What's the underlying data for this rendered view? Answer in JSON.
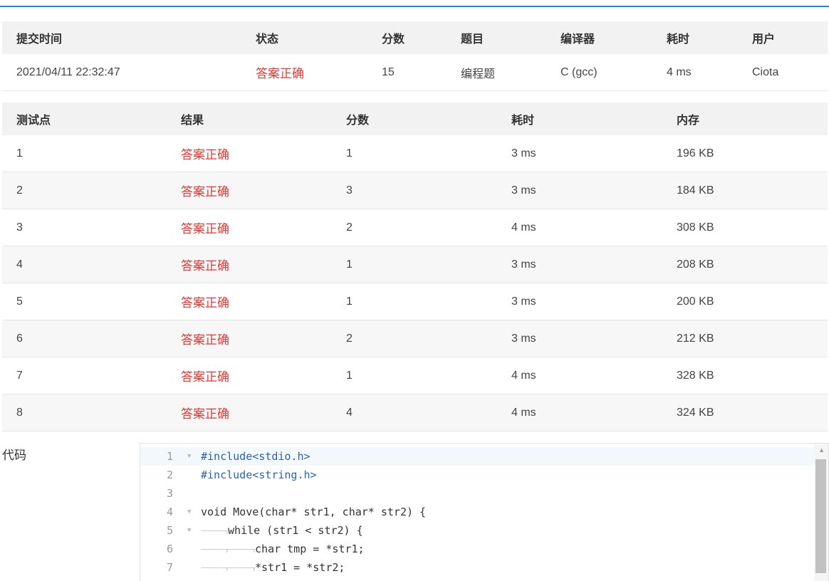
{
  "submission": {
    "headers": [
      "提交时间",
      "状态",
      "分数",
      "题目",
      "编译器",
      "耗时",
      "用户"
    ],
    "row": {
      "time": "2021/04/11 22:32:47",
      "status": "答案正确",
      "score": "15",
      "problem": "编程题",
      "compiler": "C (gcc)",
      "duration": "4 ms",
      "user": "Ciota"
    }
  },
  "cases": {
    "headers": [
      "测试点",
      "结果",
      "分数",
      "耗时",
      "内存"
    ],
    "rows": [
      {
        "id": "1",
        "result": "答案正确",
        "score": "1",
        "time": "3 ms",
        "memory": "196 KB"
      },
      {
        "id": "2",
        "result": "答案正确",
        "score": "3",
        "time": "3 ms",
        "memory": "184 KB"
      },
      {
        "id": "3",
        "result": "答案正确",
        "score": "2",
        "time": "4 ms",
        "memory": "308 KB"
      },
      {
        "id": "4",
        "result": "答案正确",
        "score": "1",
        "time": "3 ms",
        "memory": "208 KB"
      },
      {
        "id": "5",
        "result": "答案正确",
        "score": "1",
        "time": "3 ms",
        "memory": "200 KB"
      },
      {
        "id": "6",
        "result": "答案正确",
        "score": "2",
        "time": "3 ms",
        "memory": "212 KB"
      },
      {
        "id": "7",
        "result": "答案正确",
        "score": "1",
        "time": "4 ms",
        "memory": "328 KB"
      },
      {
        "id": "8",
        "result": "答案正确",
        "score": "4",
        "time": "4 ms",
        "memory": "324 KB"
      }
    ]
  },
  "code": {
    "label": "代码",
    "line_numbers": [
      "1",
      "2",
      "3",
      "4",
      "5",
      "6",
      "7"
    ],
    "lines": [
      "#include<stdio.h>",
      "#include<string.h>",
      "",
      "void Move(char* str1, char* str2) {",
      "while (str1 < str2) {",
      "char tmp = *str1;",
      "*str1 = *str2;"
    ]
  },
  "colors": {
    "accent": "#1e88e5",
    "status_ok": "#e53935"
  }
}
